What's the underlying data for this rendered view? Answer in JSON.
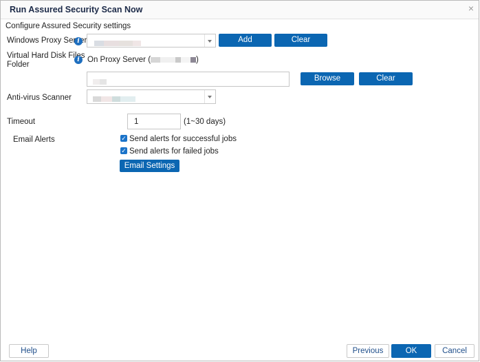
{
  "dialog": {
    "title": "Run Assured Security Scan Now",
    "close_glyph": "×"
  },
  "section_title": "Configure Assured Security settings",
  "proxy": {
    "label": "Windows Proxy Server",
    "add_label": "Add",
    "clear_label": "Clear"
  },
  "vhd": {
    "label_line1": "Virtual Hard Disk Files",
    "label_line2": "Folder",
    "option_prefix": "On Proxy Server (",
    "option_suffix": ")",
    "browse_label": "Browse",
    "clear_label": "Clear"
  },
  "antivirus": {
    "label": "Anti-virus Scanner"
  },
  "timeout": {
    "label": "Timeout",
    "value": "1",
    "hint": "(1~30 days)"
  },
  "email": {
    "label": "Email Alerts",
    "success_label": "Send alerts for successful jobs",
    "failed_label": "Send alerts for failed jobs",
    "settings_button": "Email Settings"
  },
  "footer": {
    "help": "Help",
    "previous": "Previous",
    "ok": "OK",
    "cancel": "Cancel"
  },
  "colors": {
    "primary_button": "#0b66b2",
    "info_icon": "#1f6fbf",
    "checkbox": "#1a73c9"
  },
  "icons": {
    "info": "info-icon",
    "dropdown": "chevron-down-icon",
    "close": "close-icon",
    "checkbox": "checkbox-checked-icon"
  }
}
